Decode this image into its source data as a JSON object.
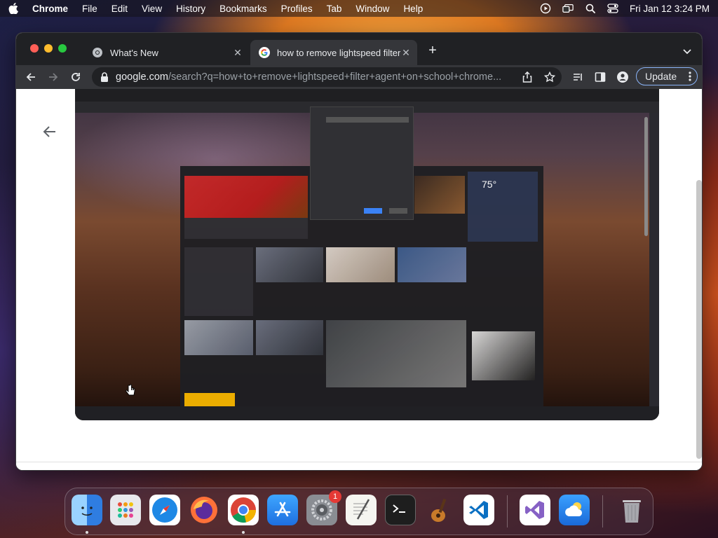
{
  "menubar": {
    "app_name": "Chrome",
    "items": [
      "File",
      "Edit",
      "View",
      "History",
      "Bookmarks",
      "Profiles",
      "Tab",
      "Window",
      "Help"
    ],
    "datetime": "Fri Jan 12  3:24 PM"
  },
  "browser": {
    "tabs": [
      {
        "label": "What's New",
        "active": false
      },
      {
        "label": "how to remove lightspeed filter",
        "active": true
      }
    ],
    "url_domain": "google.com",
    "url_path": "/search?q=how+to+remove+lightspeed+filter+agent+on+school+chrome...",
    "update_label": "Update"
  },
  "video": {
    "weather_temp": "75°"
  },
  "dock": {
    "items": [
      "Finder",
      "Launchpad",
      "Safari",
      "Firefox",
      "Chrome",
      "App Store",
      "System Settings",
      "TextEdit",
      "Terminal",
      "GarageBand",
      "Visual Studio Code",
      "Visual Studio",
      "Weather",
      "Trash"
    ],
    "settings_badge": "1"
  },
  "colors": {
    "accent": "#8ab4f8",
    "titlebar": "#202124",
    "toolbar": "#35363a"
  }
}
